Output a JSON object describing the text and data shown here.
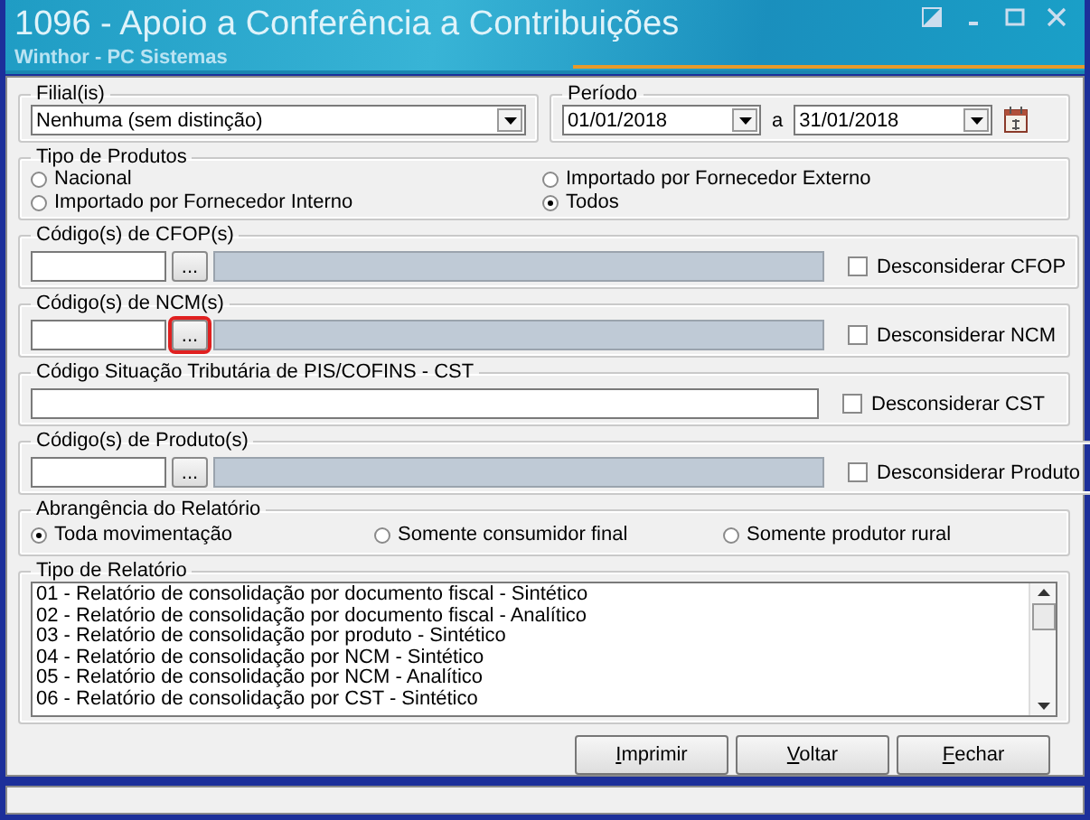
{
  "window": {
    "title": "1096 - Apoio a Conferência a Contribuições",
    "subtitle": "Winthor - PC Sistemas"
  },
  "filial": {
    "label": "Filial(is)",
    "value": "Nenhuma (sem distinção)"
  },
  "periodo": {
    "label": "Período",
    "start": "01/01/2018",
    "separator": "a",
    "end": "31/01/2018"
  },
  "tipo_produtos": {
    "label": "Tipo de Produtos",
    "options": [
      {
        "label": "Nacional",
        "selected": false
      },
      {
        "label": "Importado por Fornecedor Externo",
        "selected": false
      },
      {
        "label": "Importado por Fornecedor Interno",
        "selected": false
      },
      {
        "label": "Todos",
        "selected": true
      }
    ]
  },
  "code_groups": [
    {
      "kind": "lookup",
      "label": "Código(s) de CFOP(s)",
      "button": "...",
      "highlighted": false,
      "checkbox": {
        "label": "Desconsiderar CFOP",
        "checked": false
      }
    },
    {
      "kind": "lookup",
      "label": "Código(s) de NCM(s)",
      "button": "...",
      "highlighted": true,
      "checkbox": {
        "label": "Desconsiderar NCM",
        "checked": false
      }
    },
    {
      "kind": "text",
      "label": "Código Situação Tributária de PIS/COFINS - CST",
      "checkbox": {
        "label": "Desconsiderar CST",
        "checked": false
      }
    },
    {
      "kind": "lookup",
      "label": "Código(s) de Produto(s)",
      "button": "...",
      "highlighted": false,
      "checkbox": {
        "label": "Desconsiderar Produto",
        "checked": false
      }
    }
  ],
  "abrangencia": {
    "label": "Abrangência do Relatório",
    "options": [
      {
        "label": "Toda movimentação",
        "selected": true
      },
      {
        "label": "Somente consumidor final",
        "selected": false
      },
      {
        "label": "Somente produtor rural",
        "selected": false
      }
    ]
  },
  "tipo_relatorio": {
    "label": "Tipo de Relatório",
    "items": [
      {
        "label": "01 - Relatório de consolidação por documento fiscal - Sintético",
        "selected": false
      },
      {
        "label": "02 - Relatório de consolidação por documento fiscal - Analítico",
        "selected": false
      },
      {
        "label": "03 - Relatório de consolidação por produto - Sintético",
        "selected": false
      },
      {
        "label": "04 - Relatório de consolidação por NCM - Sintético",
        "selected": false
      },
      {
        "label": "05 - Relatório de consolidação por NCM - Analítico",
        "selected": false
      },
      {
        "label": "06 - Relatório de consolidação por CST - Sintético",
        "selected": false
      }
    ]
  },
  "buttons": [
    "Imprimir",
    "Voltar",
    "Fechar"
  ]
}
